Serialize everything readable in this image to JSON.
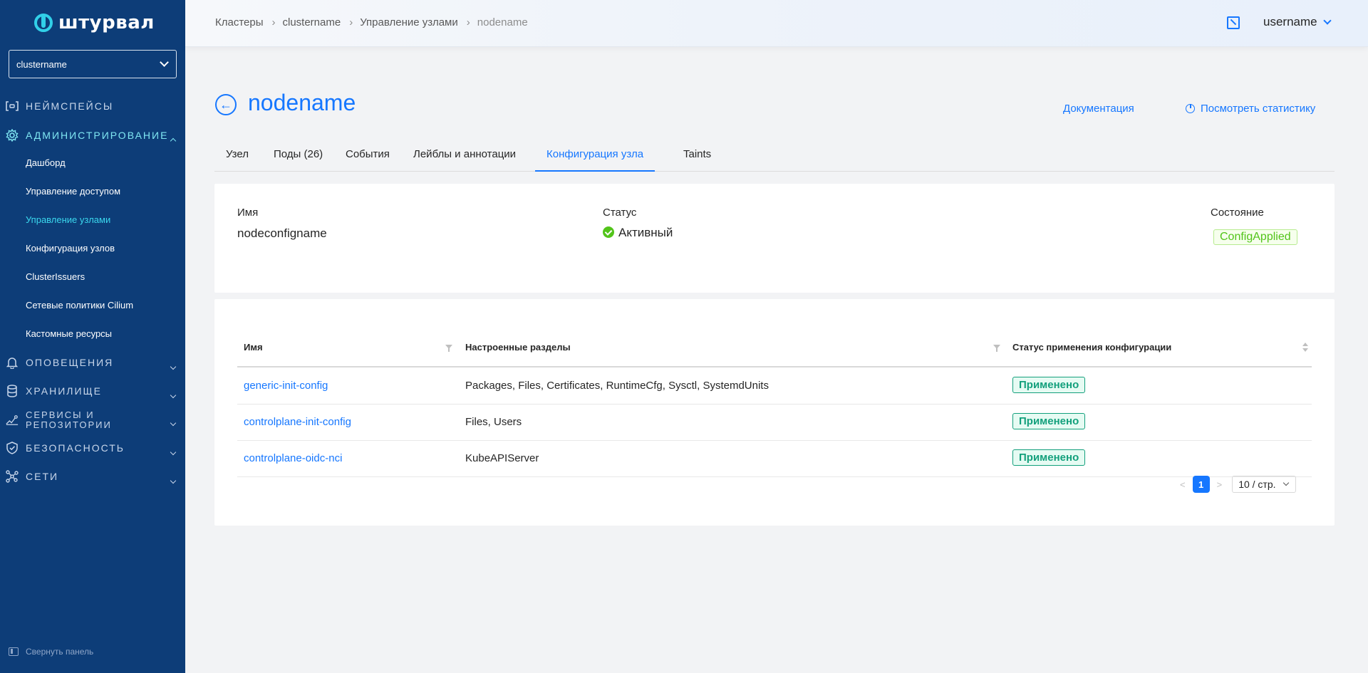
{
  "app": {
    "logo_text": "штурвал",
    "cluster_select": "clustername",
    "collapse_label": "Свернуть панель"
  },
  "sidebar": {
    "sections": [
      {
        "label": "НЕЙМСПЕЙСЫ",
        "icon": "namespaces-icon"
      },
      {
        "label": "АДМИНИСТРИРОВАНИЕ",
        "icon": "gear-icon",
        "expanded": true
      },
      {
        "label": "ОПОВЕЩЕНИЯ",
        "icon": "bell-icon"
      },
      {
        "label": "ХРАНИЛИЩЕ",
        "icon": "database-icon"
      },
      {
        "label_line1": "СЕРВИСЫ И",
        "label_line2": "РЕПОЗИТОРИИ",
        "icon": "services-icon"
      },
      {
        "label": "БЕЗОПАСНОСТЬ",
        "icon": "shield-icon"
      },
      {
        "label": "СЕТИ",
        "icon": "network-icon"
      }
    ],
    "admin_items": [
      {
        "label": "Дашборд"
      },
      {
        "label": "Управление доступом"
      },
      {
        "label": "Управление узлами",
        "active": true
      },
      {
        "label": "Конфигурация узлов"
      },
      {
        "label": "ClusterIssuers"
      },
      {
        "label": "Сетевые политики Cilium"
      },
      {
        "label": "Кастомные ресурсы"
      }
    ]
  },
  "header": {
    "breadcrumb": [
      "Кластеры",
      "clustername",
      "Управление узлами",
      "nodename"
    ],
    "username": "username"
  },
  "page": {
    "title": "nodename",
    "link_docs": "Документация",
    "link_stats": "Посмотреть статистику",
    "tabs": [
      {
        "label": "Узел"
      },
      {
        "label": "Поды (26)"
      },
      {
        "label": "События"
      },
      {
        "label": "Лейблы и аннотации"
      },
      {
        "label": "Конфигурация узла",
        "active": true
      },
      {
        "label": "Taints"
      }
    ]
  },
  "info": {
    "name_label": "Имя",
    "name_value": "nodeconfigname",
    "status_label": "Статус",
    "status_value": "Активный",
    "state_label": "Состояние",
    "state_value": "ConfigApplied"
  },
  "table": {
    "columns": [
      "Имя",
      "Настроенные разделы",
      "Статус применения конфигурации"
    ],
    "rows": [
      {
        "name": "generic-init-config",
        "sections": "Packages, Files, Certificates, RuntimeCfg, Sysctl, SystemdUnits",
        "status": "Применено"
      },
      {
        "name": "controlplane-init-config",
        "sections": "Files, Users",
        "status": "Применено"
      },
      {
        "name": "controlplane-oidc-nci",
        "sections": "KubeAPIServer",
        "status": "Применено"
      }
    ],
    "pagination": {
      "current_page": "1",
      "page_size": "10 / стр."
    }
  },
  "colors": {
    "sidebar_bg": "#0d3d78",
    "accent": "#1677ff",
    "sidebar_active": "#3ad8ee",
    "success": "#52c41a",
    "applied": "#13a07c"
  }
}
